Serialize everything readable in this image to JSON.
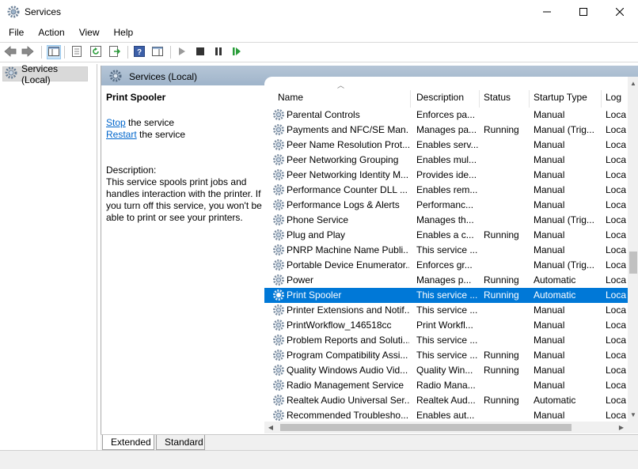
{
  "window": {
    "title": "Services",
    "icon": "gear-icon",
    "controls": {
      "minimize": "minimize-icon",
      "maximize": "maximize-icon",
      "close": "close-icon"
    }
  },
  "menu": [
    "File",
    "Action",
    "View",
    "Help"
  ],
  "toolbar": {
    "icons": [
      "back-arrow-icon",
      "forward-arrow-icon",
      "show-hide-console-tree-icon",
      "properties-icon",
      "refresh-icon",
      "export-list-icon",
      "help-icon",
      "show-hide-action-pane-icon",
      "start-service-icon",
      "stop-service-icon",
      "pause-service-icon",
      "restart-service-icon"
    ]
  },
  "tree": {
    "item": "Services (Local)"
  },
  "header": {
    "title": "Services (Local)"
  },
  "detail": {
    "service_name": "Print Spooler",
    "stop_link": "Stop",
    "stop_suffix": " the service",
    "restart_link": "Restart",
    "restart_suffix": " the service",
    "description_label": "Description:",
    "description": "This service spools print jobs and handles interaction with the printer. If you turn off this service, you won't be able to print or see your printers."
  },
  "columns": {
    "name": "Name",
    "description": "Description",
    "status": "Status",
    "startup": "Startup Type",
    "logon": "Log"
  },
  "rows": [
    {
      "name": "Parental Controls",
      "desc": "Enforces pa...",
      "status": "",
      "startup": "Manual",
      "log": "Loca"
    },
    {
      "name": "Payments and NFC/SE Man...",
      "desc": "Manages pa...",
      "status": "Running",
      "startup": "Manual (Trig...",
      "log": "Loca"
    },
    {
      "name": "Peer Name Resolution Prot...",
      "desc": "Enables serv...",
      "status": "",
      "startup": "Manual",
      "log": "Loca"
    },
    {
      "name": "Peer Networking Grouping",
      "desc": "Enables mul...",
      "status": "",
      "startup": "Manual",
      "log": "Loca"
    },
    {
      "name": "Peer Networking Identity M...",
      "desc": "Provides ide...",
      "status": "",
      "startup": "Manual",
      "log": "Loca"
    },
    {
      "name": "Performance Counter DLL ...",
      "desc": "Enables rem...",
      "status": "",
      "startup": "Manual",
      "log": "Loca"
    },
    {
      "name": "Performance Logs & Alerts",
      "desc": "Performanc...",
      "status": "",
      "startup": "Manual",
      "log": "Loca"
    },
    {
      "name": "Phone Service",
      "desc": "Manages th...",
      "status": "",
      "startup": "Manual (Trig...",
      "log": "Loca"
    },
    {
      "name": "Plug and Play",
      "desc": "Enables a c...",
      "status": "Running",
      "startup": "Manual",
      "log": "Loca"
    },
    {
      "name": "PNRP Machine Name Publi...",
      "desc": "This service ...",
      "status": "",
      "startup": "Manual",
      "log": "Loca"
    },
    {
      "name": "Portable Device Enumerator...",
      "desc": "Enforces gr...",
      "status": "",
      "startup": "Manual (Trig...",
      "log": "Loca"
    },
    {
      "name": "Power",
      "desc": "Manages p...",
      "status": "Running",
      "startup": "Automatic",
      "log": "Loca"
    },
    {
      "name": "Print Spooler",
      "desc": "This service ...",
      "status": "Running",
      "startup": "Automatic",
      "log": "Loca",
      "selected": true
    },
    {
      "name": "Printer Extensions and Notif...",
      "desc": "This service ...",
      "status": "",
      "startup": "Manual",
      "log": "Loca"
    },
    {
      "name": "PrintWorkflow_146518cc",
      "desc": "Print Workfl...",
      "status": "",
      "startup": "Manual",
      "log": "Loca"
    },
    {
      "name": "Problem Reports and Soluti...",
      "desc": "This service ...",
      "status": "",
      "startup": "Manual",
      "log": "Loca"
    },
    {
      "name": "Program Compatibility Assi...",
      "desc": "This service ...",
      "status": "Running",
      "startup": "Manual",
      "log": "Loca"
    },
    {
      "name": "Quality Windows Audio Vid...",
      "desc": "Quality Win...",
      "status": "Running",
      "startup": "Manual",
      "log": "Loca"
    },
    {
      "name": "Radio Management Service",
      "desc": "Radio Mana...",
      "status": "",
      "startup": "Manual",
      "log": "Loca"
    },
    {
      "name": "Realtek Audio Universal Ser...",
      "desc": "Realtek Aud...",
      "status": "Running",
      "startup": "Automatic",
      "log": "Loca"
    },
    {
      "name": "Recommended Troublesho...",
      "desc": "Enables aut...",
      "status": "",
      "startup": "Manual",
      "log": "Loca"
    }
  ],
  "tabs": [
    "Extended",
    "Standard"
  ],
  "colors": {
    "selection": "#0078d7",
    "header_band": "#a9bcd0",
    "link": "#0066cc"
  }
}
